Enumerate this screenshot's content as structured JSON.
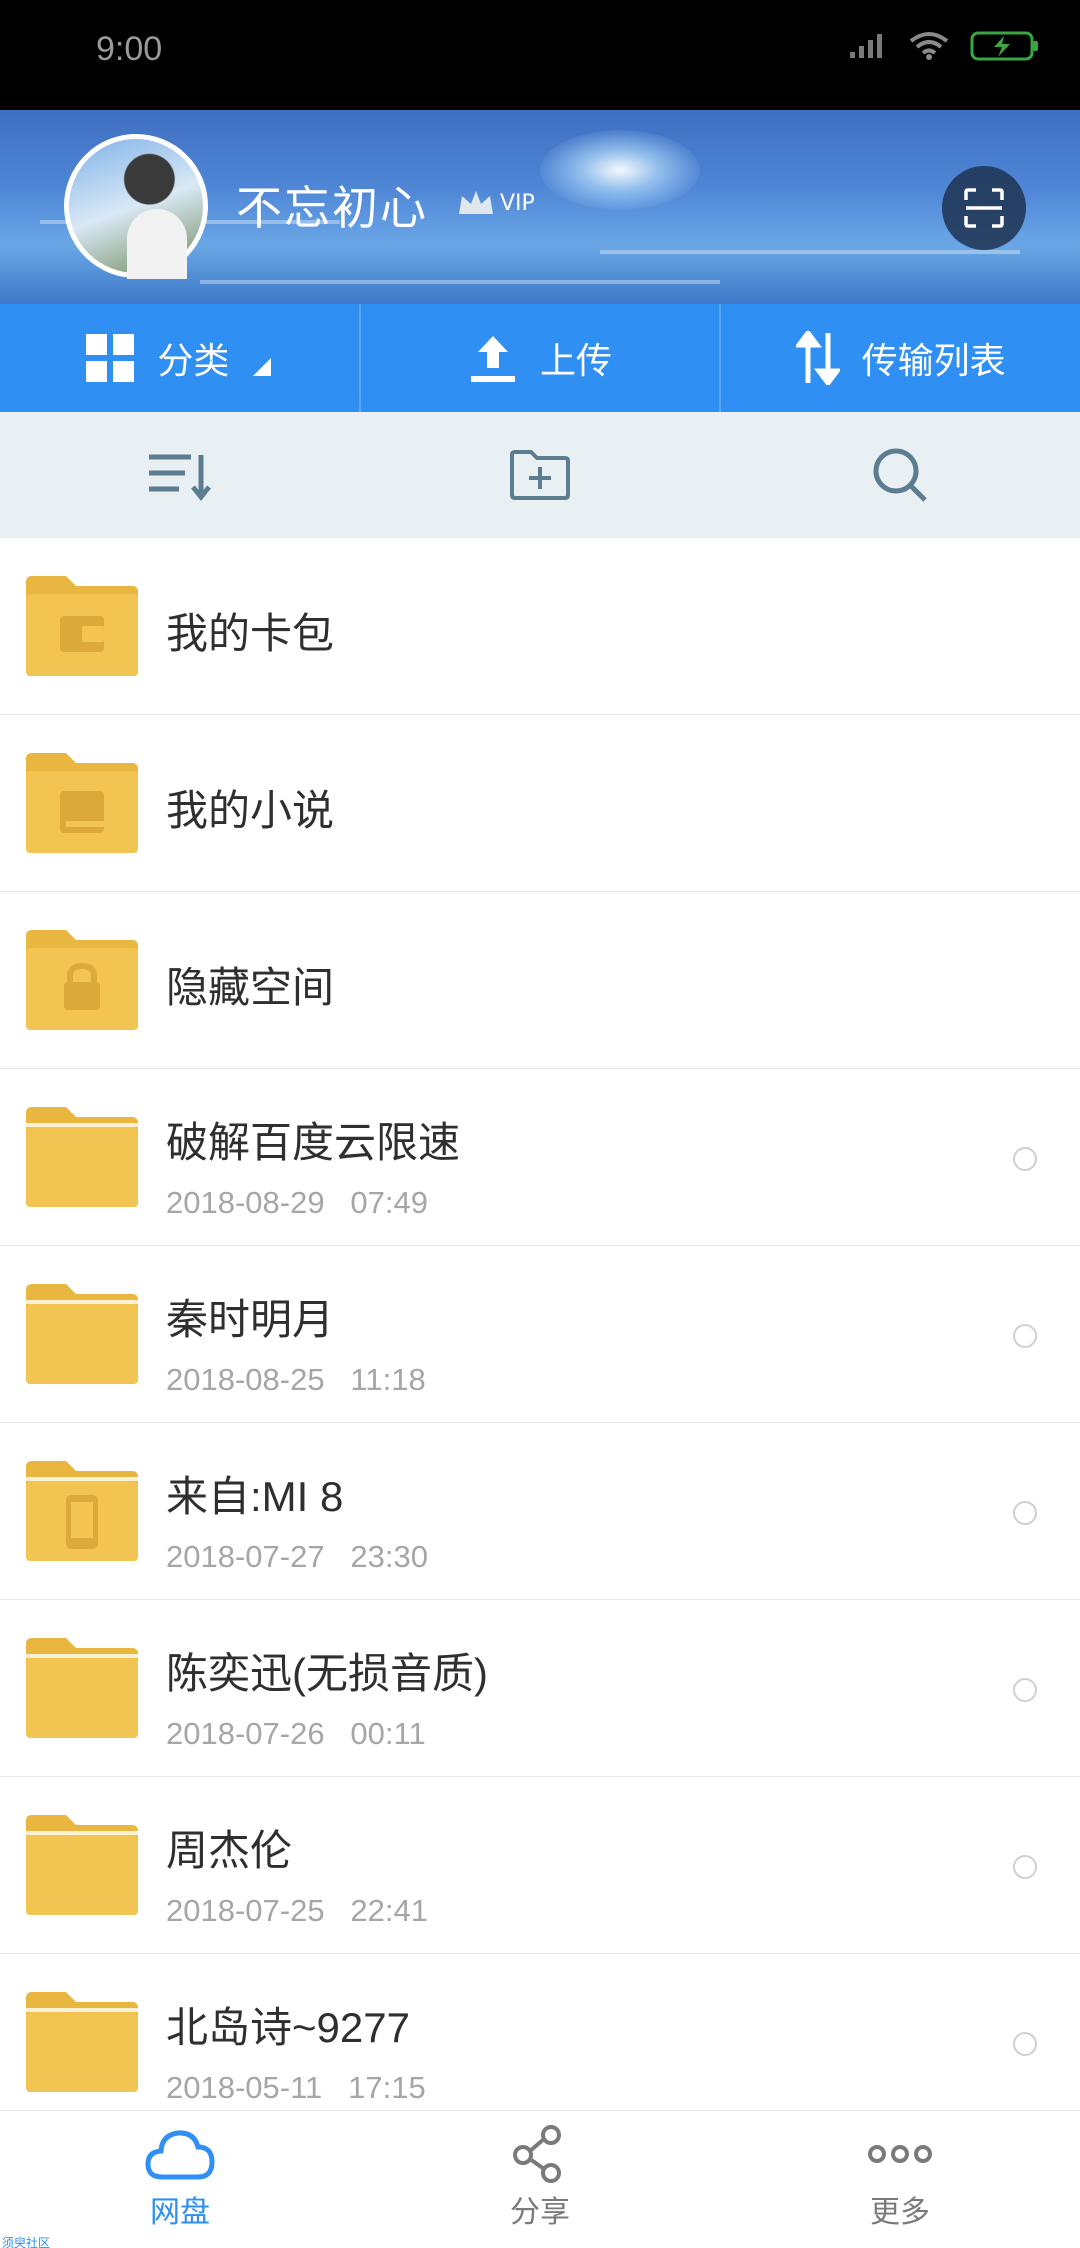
{
  "status_bar": {
    "time": "9:00"
  },
  "header": {
    "username": "不忘初心",
    "vip_label": "VIP"
  },
  "tabs": [
    {
      "label": "分类",
      "icon": "grid-icon"
    },
    {
      "label": "上传",
      "icon": "upload-icon"
    },
    {
      "label": "传输列表",
      "icon": "transfer-icon"
    }
  ],
  "toolbar": {
    "icons": [
      "sort-icon",
      "new-folder-icon",
      "search-icon"
    ]
  },
  "list": {
    "items": [
      {
        "name": "我的卡包",
        "date": "",
        "time": "",
        "folder_icon": "wallet-icon"
      },
      {
        "name": "我的小说",
        "date": "",
        "time": "",
        "folder_icon": "book-icon"
      },
      {
        "name": "隐藏空间",
        "date": "",
        "time": "",
        "folder_icon": "lock-icon"
      },
      {
        "name": "破解百度云限速",
        "date": "2018-08-29",
        "time": "07:49",
        "folder_icon": "folder-icon"
      },
      {
        "name": "秦时明月",
        "date": "2018-08-25",
        "time": "11:18",
        "folder_icon": "folder-icon"
      },
      {
        "name": "来自:MI 8",
        "date": "2018-07-27",
        "time": "23:30",
        "folder_icon": "phone-icon"
      },
      {
        "name": "陈奕迅(无损音质)",
        "date": "2018-07-26",
        "time": "00:11",
        "folder_icon": "folder-icon"
      },
      {
        "name": "周杰伦",
        "date": "2018-07-25",
        "time": "22:41",
        "folder_icon": "folder-icon"
      },
      {
        "name": "北岛诗~9277",
        "date": "2018-05-11",
        "time": "17:15",
        "folder_icon": "folder-icon"
      }
    ]
  },
  "bottom_nav": [
    {
      "label": "网盘",
      "icon": "cloud-icon",
      "active": true
    },
    {
      "label": "分享",
      "icon": "share-icon",
      "active": false
    },
    {
      "label": "更多",
      "icon": "more-icon",
      "active": false
    }
  ],
  "watermark": "须臾社区",
  "colors": {
    "primary": "#2f8ff2",
    "folder": "#f2c451",
    "toolbar_bg": "#e9f0f4"
  }
}
